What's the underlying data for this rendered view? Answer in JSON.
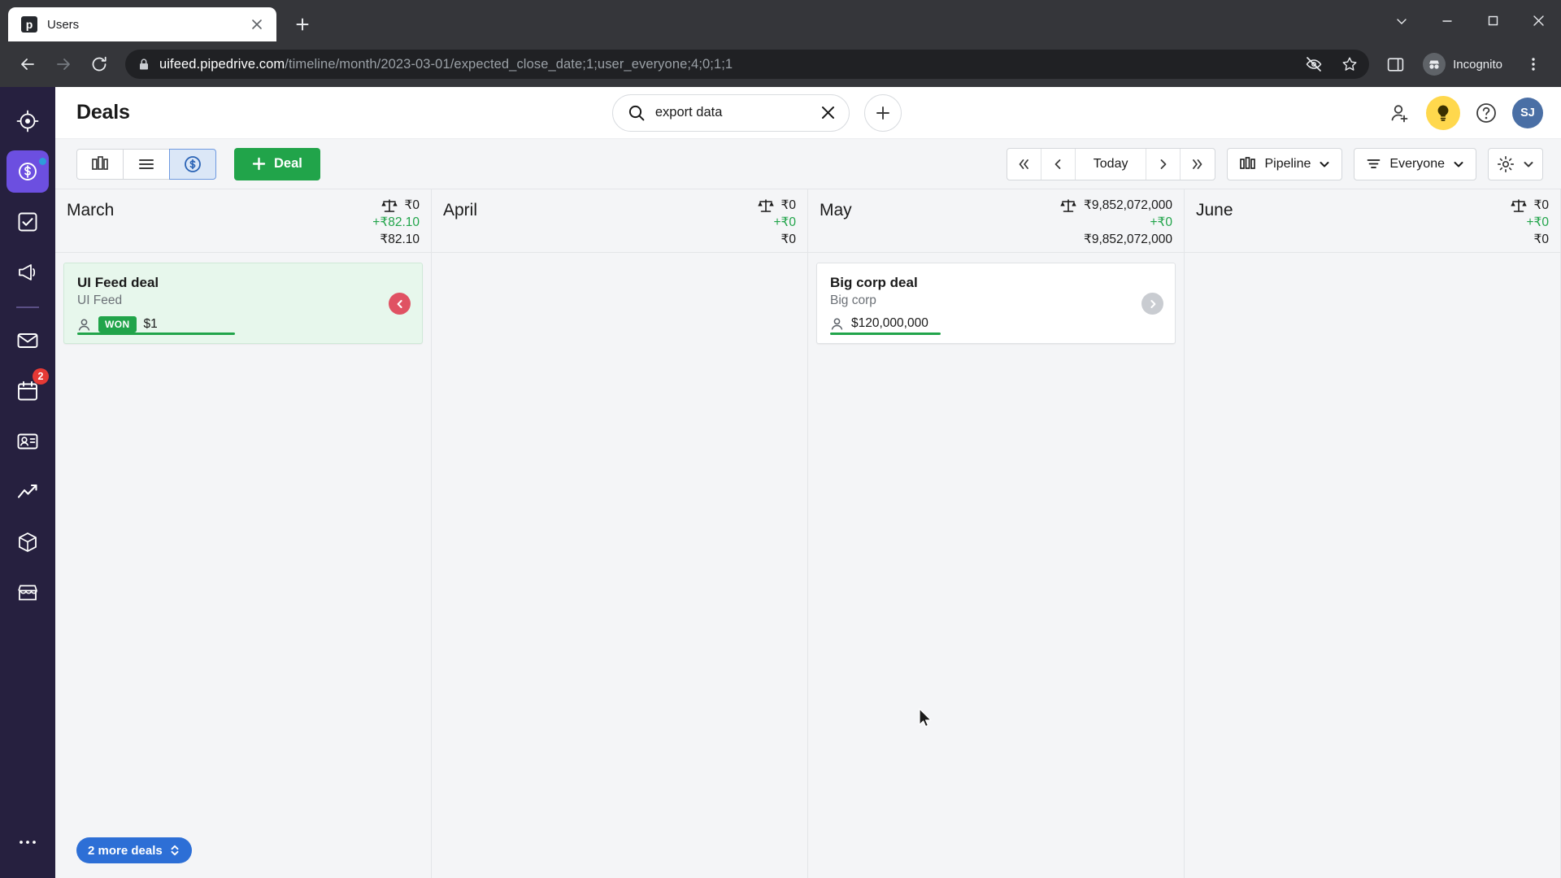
{
  "browser": {
    "tab": {
      "title": "Users",
      "favicon_letter": "p",
      "favicon_icon": "pipedrive-favicon",
      "close_icon": "close-icon"
    },
    "new_tab_icon": "plus-icon",
    "window_controls": {
      "minimize_all_icon": "chevron-down-icon",
      "minimize_icon": "minimize-icon",
      "maximize_icon": "maximize-icon",
      "close_icon": "close-icon"
    },
    "nav": {
      "back_icon": "arrow-left-icon",
      "forward_icon": "arrow-right-icon",
      "reload_icon": "reload-icon"
    },
    "omnibox": {
      "lock_icon": "lock-icon",
      "host": "uifeed.pipedrive.com",
      "path": "/timeline/month/2023-03-01/expected_close_date;1;user_everyone;4;0;1;1",
      "tracking_icon": "eye-crossed-icon",
      "bookmark_icon": "star-icon"
    },
    "side_panel_icon": "side-panel-icon",
    "incognito": {
      "label": "Incognito",
      "icon": "incognito-avatar-icon"
    },
    "menu_icon": "three-dots-vertical-icon"
  },
  "rail": {
    "items": [
      {
        "name": "leads-inbox",
        "icon": "target-icon",
        "active": false,
        "dot": false,
        "badge": ""
      },
      {
        "name": "deals",
        "icon": "dollar-circle-icon",
        "active": true,
        "dot": true,
        "badge": ""
      },
      {
        "name": "activities",
        "icon": "check-square-icon",
        "active": false,
        "dot": false,
        "badge": ""
      },
      {
        "name": "campaigns",
        "icon": "megaphone-icon",
        "active": false,
        "dot": false,
        "badge": ""
      },
      {
        "name": "mail",
        "icon": "envelope-icon",
        "active": false,
        "dot": false,
        "badge": ""
      },
      {
        "name": "calendar",
        "icon": "calendar-icon",
        "active": false,
        "dot": false,
        "badge": "2"
      },
      {
        "name": "contacts",
        "icon": "contact-card-icon",
        "active": false,
        "dot": false,
        "badge": ""
      },
      {
        "name": "insights",
        "icon": "line-chart-icon",
        "active": false,
        "dot": false,
        "badge": ""
      },
      {
        "name": "products",
        "icon": "box-icon",
        "active": false,
        "dot": false,
        "badge": ""
      },
      {
        "name": "marketplace",
        "icon": "store-icon",
        "active": false,
        "dot": false,
        "badge": ""
      }
    ],
    "more_icon": "three-dots-icon"
  },
  "header": {
    "title": "Deals",
    "search": {
      "value": "export data",
      "placeholder": "Search",
      "search_icon": "search-icon",
      "clear_icon": "close-icon"
    },
    "add_icon": "plus-icon",
    "invite_icon": "add-user-icon",
    "tips_icon": "lightbulb-icon",
    "help_icon": "question-circle-icon",
    "avatar_initials": "SJ"
  },
  "toolbar": {
    "views": [
      {
        "name": "pipeline-view",
        "icon": "kanban-icon",
        "active": false
      },
      {
        "name": "list-view",
        "icon": "list-icon",
        "active": false
      },
      {
        "name": "forecast-view",
        "icon": "dollar-circle-icon",
        "active": true
      }
    ],
    "deal_button": {
      "label": "Deal",
      "plus_icon": "plus-icon"
    },
    "pager": {
      "first_icon": "double-chevron-left-icon",
      "prev_icon": "chevron-left-icon",
      "today_label": "Today",
      "next_icon": "chevron-right-icon",
      "last_icon": "double-chevron-right-icon"
    },
    "pipeline_filter": {
      "label": "Pipeline",
      "icon": "pipeline-icon",
      "caret_icon": "chevron-down-icon"
    },
    "user_filter": {
      "label": "Everyone",
      "icon": "filter-icon",
      "caret_icon": "chevron-down-icon"
    },
    "settings": {
      "icon": "gear-icon",
      "caret_icon": "chevron-down-icon"
    }
  },
  "timeline": {
    "scales_icon": "scales-icon",
    "columns": [
      {
        "month": "March",
        "weighted_value": "₹0",
        "won_value": "+₹82.10",
        "total_value": "₹82.10",
        "deals": [
          {
            "title": "UI Feed deal",
            "org": "UI Feed",
            "person_icon": "person-icon",
            "badge": "WON",
            "value": "$1",
            "won": true,
            "arrow_icon": "chevron-left-circle-icon",
            "arrow_color": "red",
            "progress_pct": 100
          }
        ]
      },
      {
        "month": "April",
        "weighted_value": "₹0",
        "won_value": "+₹0",
        "total_value": "₹0",
        "deals": []
      },
      {
        "month": "May",
        "weighted_value": "₹9,852,072,000",
        "won_value": "+₹0",
        "total_value": "₹9,852,072,000",
        "deals": [
          {
            "title": "Big corp deal",
            "org": "Big corp",
            "person_icon": "person-icon",
            "badge": "",
            "value": "$120,000,000",
            "won": false,
            "arrow_icon": "chevron-right-circle-icon",
            "arrow_color": "grey",
            "progress_pct": 80
          }
        ]
      },
      {
        "month": "June",
        "weighted_value": "₹0",
        "won_value": "+₹0",
        "total_value": "₹0",
        "deals": []
      }
    ],
    "more_deals": {
      "label": "2 more deals",
      "icon": "chevron-updown-icon"
    }
  },
  "colors": {
    "brand_purple": "#26203f",
    "accent_purple": "#6c4fe0",
    "green": "#21a44a",
    "blue": "#2d6fd6",
    "won_bg": "#e7f7ec",
    "red": "#e05263",
    "badge_red": "#e53935",
    "yellow": "#ffd84d"
  }
}
